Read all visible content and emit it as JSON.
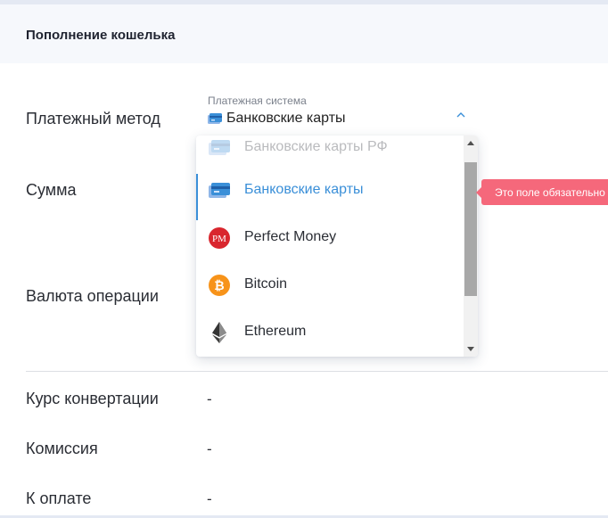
{
  "header": {
    "title": "Пополнение кошелька"
  },
  "form": {
    "payment_method_label": "Платежный метод",
    "amount_label": "Сумма",
    "currency_label": "Валюта операции",
    "select": {
      "caption": "Платежная система",
      "value": "Банковские карты"
    }
  },
  "dropdown": {
    "options": [
      {
        "label": "Банковские карты РФ",
        "icon": "bank-card-icon",
        "state": "faded"
      },
      {
        "label": "Банковские карты",
        "icon": "bank-card-icon",
        "state": "selected"
      },
      {
        "label": "Perfect Money",
        "icon": "perfect-money-icon",
        "state": "normal"
      },
      {
        "label": "Bitcoin",
        "icon": "bitcoin-icon",
        "state": "normal"
      },
      {
        "label": "Ethereum",
        "icon": "ethereum-icon",
        "state": "normal"
      }
    ]
  },
  "tooltip": {
    "text": "Это поле обязательно"
  },
  "summary": {
    "rate_label": "Курс конвертации",
    "rate_value": "-",
    "fee_label": "Комиссия",
    "fee_value": "-",
    "total_label": "К оплате",
    "total_value": "-"
  },
  "colors": {
    "accent": "#3a8fd8",
    "error": "#f5687b",
    "header_bg": "#f6f8fc",
    "perfect_money": "#d9262e",
    "bitcoin": "#f7931a"
  }
}
